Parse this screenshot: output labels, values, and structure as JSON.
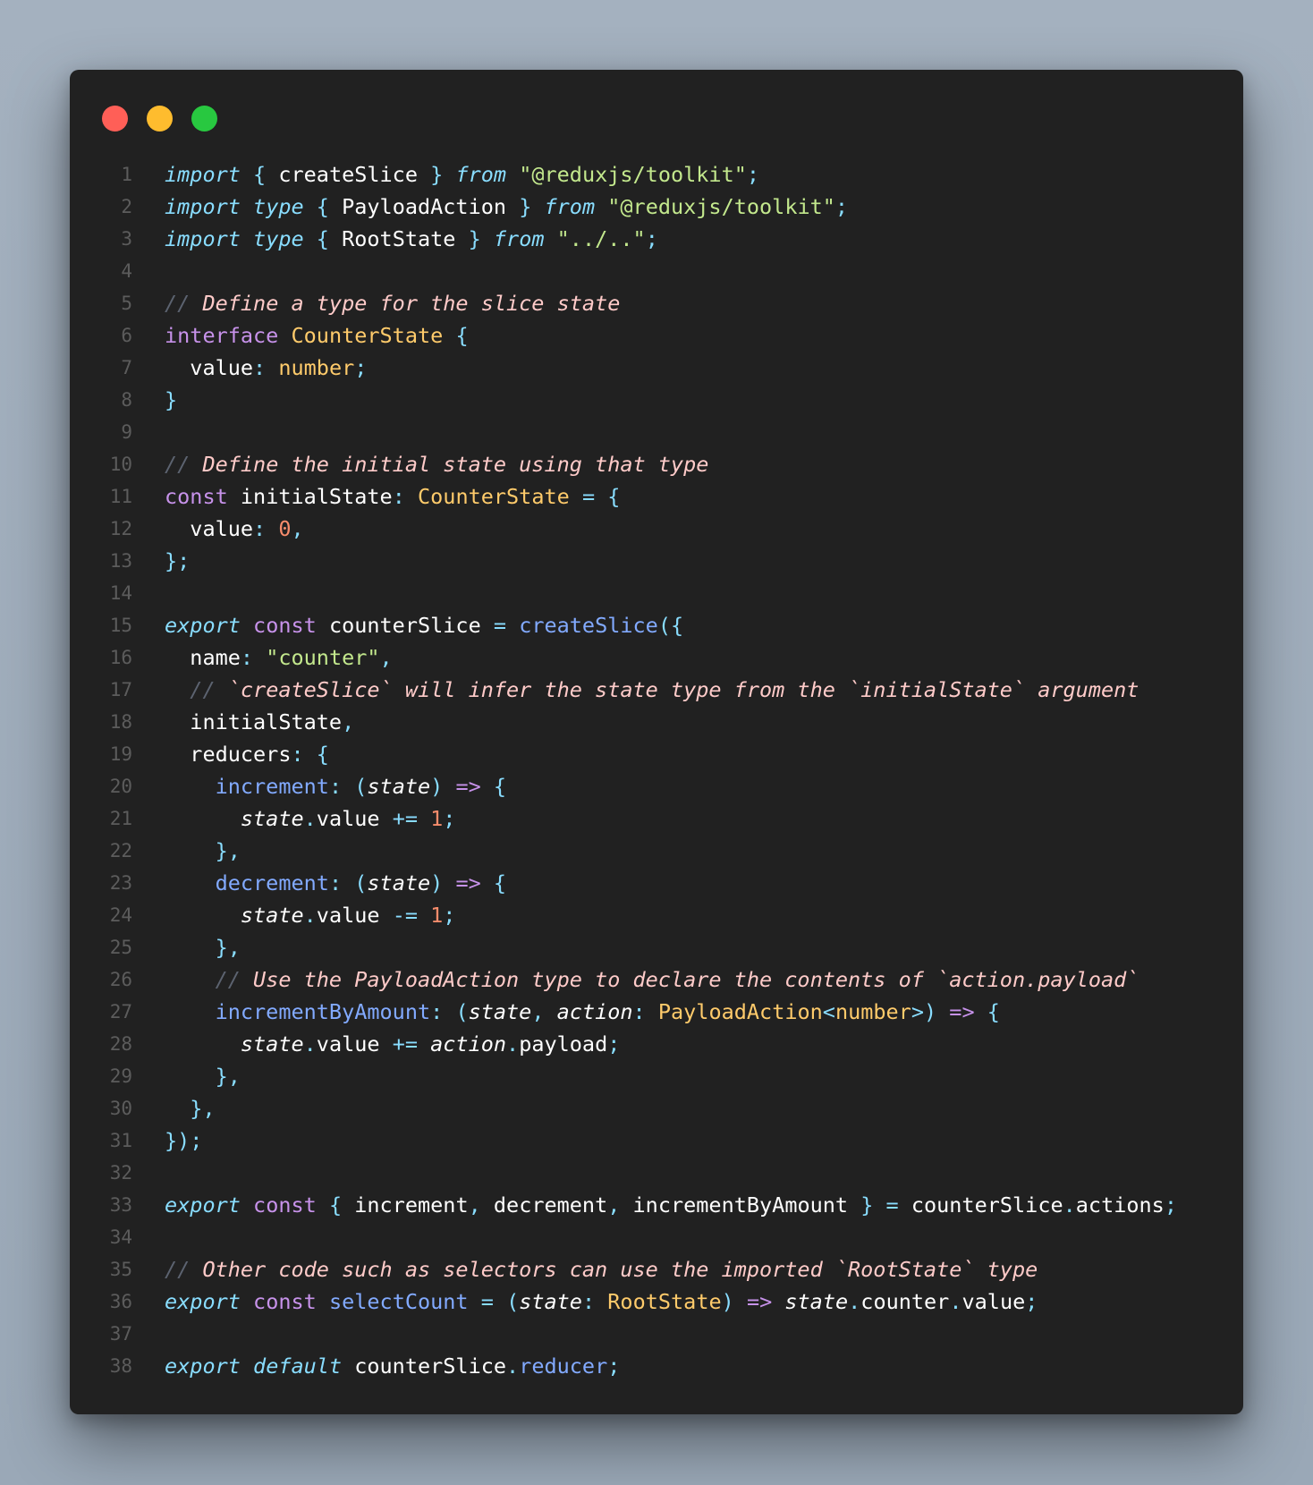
{
  "window": {
    "traffic_lights": [
      {
        "name": "close",
        "color": "#ff5f57"
      },
      {
        "name": "minimize",
        "color": "#febc2e"
      },
      {
        "name": "maximize",
        "color": "#28c840"
      }
    ]
  },
  "lines": [
    {
      "n": "1",
      "t": [
        [
          "kw-i",
          "import"
        ],
        [
          "pr",
          " "
        ],
        [
          "br",
          "{"
        ],
        [
          "pr",
          " createSlice "
        ],
        [
          "br",
          "}"
        ],
        [
          "pr",
          " "
        ],
        [
          "kw-i",
          "from"
        ],
        [
          "pr",
          " "
        ],
        [
          "str",
          "\"@reduxjs/toolkit\""
        ],
        [
          "br",
          ";"
        ]
      ]
    },
    {
      "n": "2",
      "t": [
        [
          "kw-i",
          "import"
        ],
        [
          "pr",
          " "
        ],
        [
          "kw-i",
          "type"
        ],
        [
          "pr",
          " "
        ],
        [
          "br",
          "{"
        ],
        [
          "pr",
          " PayloadAction "
        ],
        [
          "br",
          "}"
        ],
        [
          "pr",
          " "
        ],
        [
          "kw-i",
          "from"
        ],
        [
          "pr",
          " "
        ],
        [
          "str",
          "\"@reduxjs/toolkit\""
        ],
        [
          "br",
          ";"
        ]
      ]
    },
    {
      "n": "3",
      "t": [
        [
          "kw-i",
          "import"
        ],
        [
          "pr",
          " "
        ],
        [
          "kw-i",
          "type"
        ],
        [
          "pr",
          " "
        ],
        [
          "br",
          "{"
        ],
        [
          "pr",
          " RootState "
        ],
        [
          "br",
          "}"
        ],
        [
          "pr",
          " "
        ],
        [
          "kw-i",
          "from"
        ],
        [
          "pr",
          " "
        ],
        [
          "str",
          "\"../..\""
        ],
        [
          "br",
          ";"
        ]
      ]
    },
    {
      "n": "4",
      "t": []
    },
    {
      "n": "5",
      "t": [
        [
          "cm-sl",
          "// "
        ],
        [
          "cm",
          "Define a type for the slice state"
        ]
      ]
    },
    {
      "n": "6",
      "t": [
        [
          "kw",
          "interface"
        ],
        [
          "pr",
          " "
        ],
        [
          "ty",
          "CounterState"
        ],
        [
          "pr",
          " "
        ],
        [
          "br",
          "{"
        ]
      ]
    },
    {
      "n": "7",
      "t": [
        [
          "pr",
          "  value"
        ],
        [
          "br",
          ":"
        ],
        [
          "pr",
          " "
        ],
        [
          "ty",
          "number"
        ],
        [
          "br",
          ";"
        ]
      ]
    },
    {
      "n": "8",
      "t": [
        [
          "br",
          "}"
        ]
      ]
    },
    {
      "n": "9",
      "t": []
    },
    {
      "n": "10",
      "t": [
        [
          "cm-sl",
          "// "
        ],
        [
          "cm",
          "Define the initial state using that type"
        ]
      ]
    },
    {
      "n": "11",
      "t": [
        [
          "kw",
          "const"
        ],
        [
          "pr",
          " initialState"
        ],
        [
          "br",
          ":"
        ],
        [
          "pr",
          " "
        ],
        [
          "ty",
          "CounterState"
        ],
        [
          "pr",
          " "
        ],
        [
          "op",
          "="
        ],
        [
          "pr",
          " "
        ],
        [
          "br",
          "{"
        ]
      ]
    },
    {
      "n": "12",
      "t": [
        [
          "pr",
          "  value"
        ],
        [
          "br",
          ":"
        ],
        [
          "pr",
          " "
        ],
        [
          "num",
          "0"
        ],
        [
          "br",
          ","
        ]
      ]
    },
    {
      "n": "13",
      "t": [
        [
          "br",
          "};"
        ]
      ]
    },
    {
      "n": "14",
      "t": []
    },
    {
      "n": "15",
      "t": [
        [
          "kw-i",
          "export"
        ],
        [
          "pr",
          " "
        ],
        [
          "kw",
          "const"
        ],
        [
          "pr",
          " counterSlice "
        ],
        [
          "op",
          "="
        ],
        [
          "pr",
          " "
        ],
        [
          "fn",
          "createSlice"
        ],
        [
          "br",
          "({"
        ]
      ]
    },
    {
      "n": "16",
      "t": [
        [
          "pr",
          "  name"
        ],
        [
          "br",
          ":"
        ],
        [
          "pr",
          " "
        ],
        [
          "str",
          "\"counter\""
        ],
        [
          "br",
          ","
        ]
      ]
    },
    {
      "n": "17",
      "t": [
        [
          "pr",
          "  "
        ],
        [
          "cm-sl",
          "// "
        ],
        [
          "cm",
          "`createSlice` will infer the state type from the `initialState` argument"
        ]
      ]
    },
    {
      "n": "18",
      "t": [
        [
          "pr",
          "  initialState"
        ],
        [
          "br",
          ","
        ]
      ]
    },
    {
      "n": "19",
      "t": [
        [
          "pr",
          "  reducers"
        ],
        [
          "br",
          ":"
        ],
        [
          "pr",
          " "
        ],
        [
          "br",
          "{"
        ]
      ]
    },
    {
      "n": "20",
      "t": [
        [
          "pr",
          "    "
        ],
        [
          "fn",
          "increment"
        ],
        [
          "br",
          ":"
        ],
        [
          "pr",
          " "
        ],
        [
          "br",
          "("
        ],
        [
          "it",
          "state"
        ],
        [
          "br",
          ")"
        ],
        [
          "pr",
          " "
        ],
        [
          "kw",
          "=>"
        ],
        [
          "pr",
          " "
        ],
        [
          "br",
          "{"
        ]
      ]
    },
    {
      "n": "21",
      "t": [
        [
          "pr",
          "      "
        ],
        [
          "it",
          "state"
        ],
        [
          "br",
          "."
        ],
        [
          "pr",
          "value "
        ],
        [
          "op",
          "+="
        ],
        [
          "pr",
          " "
        ],
        [
          "num",
          "1"
        ],
        [
          "br",
          ";"
        ]
      ]
    },
    {
      "n": "22",
      "t": [
        [
          "pr",
          "    "
        ],
        [
          "br",
          "},"
        ]
      ]
    },
    {
      "n": "23",
      "t": [
        [
          "pr",
          "    "
        ],
        [
          "fn",
          "decrement"
        ],
        [
          "br",
          ":"
        ],
        [
          "pr",
          " "
        ],
        [
          "br",
          "("
        ],
        [
          "it",
          "state"
        ],
        [
          "br",
          ")"
        ],
        [
          "pr",
          " "
        ],
        [
          "kw",
          "=>"
        ],
        [
          "pr",
          " "
        ],
        [
          "br",
          "{"
        ]
      ]
    },
    {
      "n": "24",
      "t": [
        [
          "pr",
          "      "
        ],
        [
          "it",
          "state"
        ],
        [
          "br",
          "."
        ],
        [
          "pr",
          "value "
        ],
        [
          "op",
          "-="
        ],
        [
          "pr",
          " "
        ],
        [
          "num",
          "1"
        ],
        [
          "br",
          ";"
        ]
      ]
    },
    {
      "n": "25",
      "t": [
        [
          "pr",
          "    "
        ],
        [
          "br",
          "},"
        ]
      ]
    },
    {
      "n": "26",
      "t": [
        [
          "pr",
          "    "
        ],
        [
          "cm-sl",
          "// "
        ],
        [
          "cm",
          "Use the PayloadAction type to declare the contents of `action.payload`"
        ]
      ]
    },
    {
      "n": "27",
      "t": [
        [
          "pr",
          "    "
        ],
        [
          "fn",
          "incrementByAmount"
        ],
        [
          "br",
          ":"
        ],
        [
          "pr",
          " "
        ],
        [
          "br",
          "("
        ],
        [
          "it",
          "state"
        ],
        [
          "br",
          ","
        ],
        [
          "pr",
          " "
        ],
        [
          "it",
          "action"
        ],
        [
          "br",
          ":"
        ],
        [
          "pr",
          " "
        ],
        [
          "ty",
          "PayloadAction"
        ],
        [
          "br",
          "<"
        ],
        [
          "ty",
          "number"
        ],
        [
          "br",
          ">)"
        ],
        [
          "pr",
          " "
        ],
        [
          "kw",
          "=>"
        ],
        [
          "pr",
          " "
        ],
        [
          "br",
          "{"
        ]
      ]
    },
    {
      "n": "28",
      "t": [
        [
          "pr",
          "      "
        ],
        [
          "it",
          "state"
        ],
        [
          "br",
          "."
        ],
        [
          "pr",
          "value "
        ],
        [
          "op",
          "+="
        ],
        [
          "pr",
          " "
        ],
        [
          "it",
          "action"
        ],
        [
          "br",
          "."
        ],
        [
          "pr",
          "payload"
        ],
        [
          "br",
          ";"
        ]
      ]
    },
    {
      "n": "29",
      "t": [
        [
          "pr",
          "    "
        ],
        [
          "br",
          "},"
        ]
      ]
    },
    {
      "n": "30",
      "t": [
        [
          "pr",
          "  "
        ],
        [
          "br",
          "},"
        ]
      ]
    },
    {
      "n": "31",
      "t": [
        [
          "br",
          "});"
        ]
      ]
    },
    {
      "n": "32",
      "t": []
    },
    {
      "n": "33",
      "t": [
        [
          "kw-i",
          "export"
        ],
        [
          "pr",
          " "
        ],
        [
          "kw",
          "const"
        ],
        [
          "pr",
          " "
        ],
        [
          "br",
          "{"
        ],
        [
          "pr",
          " increment"
        ],
        [
          "br",
          ","
        ],
        [
          "pr",
          " decrement"
        ],
        [
          "br",
          ","
        ],
        [
          "pr",
          " incrementByAmount "
        ],
        [
          "br",
          "}"
        ],
        [
          "pr",
          " "
        ],
        [
          "op",
          "="
        ],
        [
          "pr",
          " counterSlice"
        ],
        [
          "br",
          "."
        ],
        [
          "pr",
          "actions"
        ],
        [
          "br",
          ";"
        ]
      ]
    },
    {
      "n": "34",
      "t": []
    },
    {
      "n": "35",
      "t": [
        [
          "cm-sl",
          "// "
        ],
        [
          "cm",
          "Other code such as selectors can use the imported `RootState` type"
        ]
      ]
    },
    {
      "n": "36",
      "t": [
        [
          "kw-i",
          "export"
        ],
        [
          "pr",
          " "
        ],
        [
          "kw",
          "const"
        ],
        [
          "pr",
          " "
        ],
        [
          "fn",
          "selectCount"
        ],
        [
          "pr",
          " "
        ],
        [
          "op",
          "="
        ],
        [
          "pr",
          " "
        ],
        [
          "br",
          "("
        ],
        [
          "it",
          "state"
        ],
        [
          "br",
          ":"
        ],
        [
          "pr",
          " "
        ],
        [
          "ty",
          "RootState"
        ],
        [
          "br",
          ")"
        ],
        [
          "pr",
          " "
        ],
        [
          "kw",
          "=>"
        ],
        [
          "pr",
          " "
        ],
        [
          "it",
          "state"
        ],
        [
          "br",
          "."
        ],
        [
          "pr",
          "counter"
        ],
        [
          "br",
          "."
        ],
        [
          "pr",
          "value"
        ],
        [
          "br",
          ";"
        ]
      ]
    },
    {
      "n": "37",
      "t": []
    },
    {
      "n": "38",
      "t": [
        [
          "kw-i",
          "export"
        ],
        [
          "pr",
          " "
        ],
        [
          "kw-i",
          "default"
        ],
        [
          "pr",
          " counterSlice"
        ],
        [
          "br",
          "."
        ],
        [
          "fn",
          "reducer"
        ],
        [
          "br",
          ";"
        ]
      ]
    }
  ]
}
